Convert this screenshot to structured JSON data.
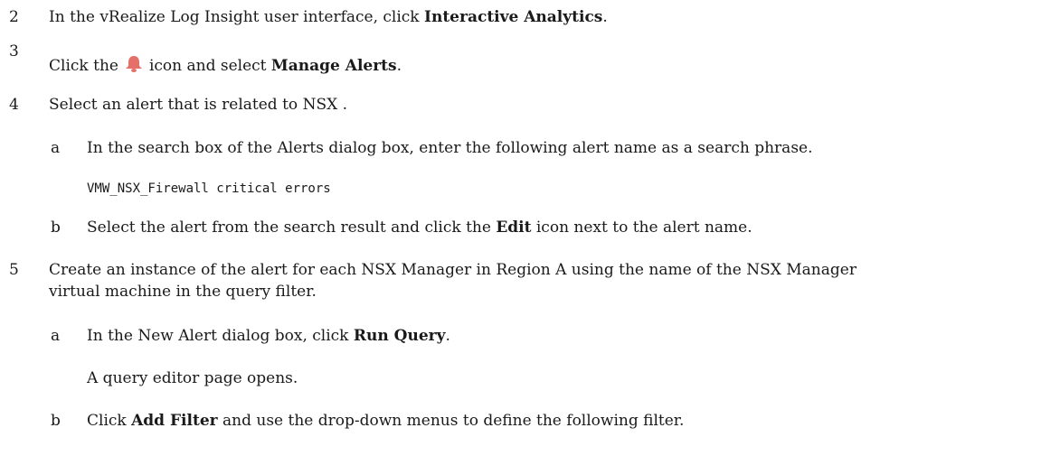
{
  "steps": [
    {
      "number": "2",
      "text_before": "In the vRealize Log Insight user interface, click ",
      "bold": "Interactive Analytics",
      "text_after": "."
    },
    {
      "number": "3",
      "text_before": "Click the",
      "icon": "bell-alert-icon",
      "text_mid": "icon and select ",
      "bold": "Manage Alerts",
      "text_after": "."
    },
    {
      "number": "4",
      "text": "Select an alert that is related to NSX .",
      "substeps": [
        {
          "letter": "a",
          "text": "In the search box of the Alerts dialog box, enter the following alert name as a search phrase.",
          "code": "VMW_NSX_Firewall critical errors"
        },
        {
          "letter": "b",
          "text_before": "Select the alert from the search result and click the ",
          "bold": "Edit",
          "text_after": " icon next to the alert name."
        }
      ]
    },
    {
      "number": "5",
      "text_line1": "Create an instance of the alert for each NSX Manager in Region A using the name of the NSX Manager",
      "text_line2": "virtual machine in the query filter.",
      "substeps": [
        {
          "letter": "a",
          "text_before": "In the New Alert dialog box, click ",
          "bold": "Run Query",
          "text_after": ".",
          "result": "A query editor page opens."
        },
        {
          "letter": "b",
          "text_before": "Click ",
          "bold": "Add Filter",
          "text_after": " and use the drop-down menus to define the following filter."
        }
      ]
    }
  ],
  "colors": {
    "text": "#1a1a1a",
    "bell": "#e5706a"
  }
}
